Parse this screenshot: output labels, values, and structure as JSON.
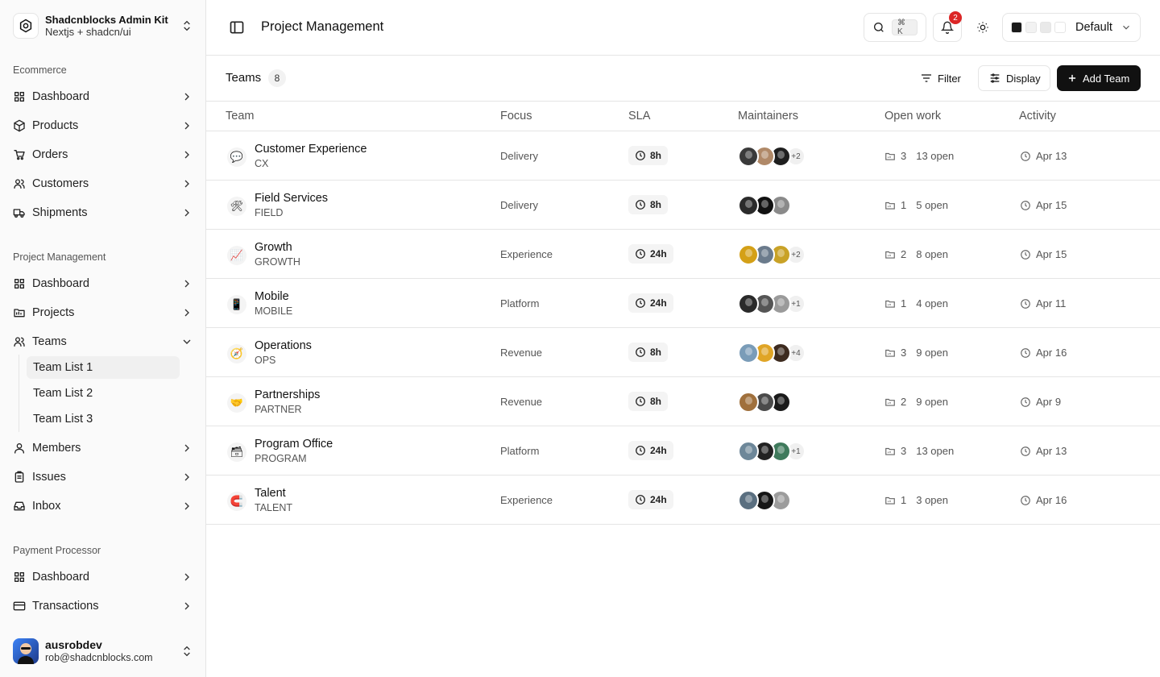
{
  "brand": {
    "title": "Shadcnblocks Admin Kit",
    "subtitle": "Nextjs + shadcn/ui"
  },
  "sidebar": {
    "groups": [
      {
        "label": "Ecommerce",
        "items": [
          {
            "label": "Dashboard",
            "icon": "grid-icon"
          },
          {
            "label": "Products",
            "icon": "box-icon"
          },
          {
            "label": "Orders",
            "icon": "cart-icon"
          },
          {
            "label": "Customers",
            "icon": "users-icon"
          },
          {
            "label": "Shipments",
            "icon": "truck-icon"
          }
        ]
      },
      {
        "label": "Project Management",
        "items": [
          {
            "label": "Dashboard",
            "icon": "grid-icon"
          },
          {
            "label": "Projects",
            "icon": "folder-icon"
          },
          {
            "label": "Teams",
            "icon": "users-icon",
            "expanded": true,
            "children": [
              "Team List 1",
              "Team List 2",
              "Team List 3"
            ],
            "active_child": "Team List 1"
          },
          {
            "label": "Members",
            "icon": "user-icon"
          },
          {
            "label": "Issues",
            "icon": "clipboard-icon"
          },
          {
            "label": "Inbox",
            "icon": "inbox-icon"
          }
        ]
      },
      {
        "label": "Payment Processor",
        "items": [
          {
            "label": "Dashboard",
            "icon": "grid-icon"
          },
          {
            "label": "Transactions",
            "icon": "card-icon"
          }
        ]
      }
    ]
  },
  "user": {
    "name": "ausrobdev",
    "email": "rob@shadcnblocks.com"
  },
  "header": {
    "title": "Project Management",
    "search_kbd": "⌘ K",
    "notifications": "2",
    "theme_name": "Default",
    "swatches": [
      "#1a1a1a",
      "#f2f2f2",
      "#e9e9e9",
      "#ffffff"
    ]
  },
  "toolbar": {
    "title": "Teams",
    "count": "8",
    "filter": "Filter",
    "display": "Display",
    "add": "Add Team"
  },
  "table": {
    "columns": [
      "Team",
      "Focus",
      "SLA",
      "Maintainers",
      "Open work",
      "Activity"
    ],
    "rows": [
      {
        "emoji": "💬",
        "name": "Customer Experience",
        "code": "CX",
        "focus": "Delivery",
        "sla": "8h",
        "avatars": [
          "#3a3a3a",
          "#b08968",
          "#1f1f1f"
        ],
        "more": "+2",
        "projects": "3",
        "open": "13 open",
        "activity": "Apr 13"
      },
      {
        "emoji": "🛠",
        "name": "Field Services",
        "code": "FIELD",
        "focus": "Delivery",
        "sla": "8h",
        "avatars": [
          "#2b2b2b",
          "#111111",
          "#8a8a8a"
        ],
        "more": "",
        "projects": "1",
        "open": "5 open",
        "activity": "Apr 15"
      },
      {
        "emoji": "📈",
        "name": "Growth",
        "code": "GROWTH",
        "focus": "Experience",
        "sla": "24h",
        "avatars": [
          "#d4a017",
          "#6b7b8c",
          "#c9a227"
        ],
        "more": "+2",
        "projects": "2",
        "open": "8 open",
        "activity": "Apr 15"
      },
      {
        "emoji": "📱",
        "name": "Mobile",
        "code": "MOBILE",
        "focus": "Platform",
        "sla": "24h",
        "avatars": [
          "#2a2a2a",
          "#555555",
          "#9a9a9a"
        ],
        "more": "+1",
        "projects": "1",
        "open": "4 open",
        "activity": "Apr 11"
      },
      {
        "emoji": "🧭",
        "name": "Operations",
        "code": "OPS",
        "focus": "Revenue",
        "sla": "8h",
        "avatars": [
          "#7a9cb8",
          "#e0a526",
          "#3d2b1f"
        ],
        "more": "+4",
        "projects": "3",
        "open": "9 open",
        "activity": "Apr 16"
      },
      {
        "emoji": "🤝",
        "name": "Partnerships",
        "code": "PARTNER",
        "focus": "Revenue",
        "sla": "8h",
        "avatars": [
          "#a0703c",
          "#4a4a4a",
          "#1a1a1a"
        ],
        "more": "",
        "projects": "2",
        "open": "9 open",
        "activity": "Apr 9"
      },
      {
        "emoji": "🗃",
        "name": "Program Office",
        "code": "PROGRAM",
        "focus": "Platform",
        "sla": "24h",
        "avatars": [
          "#6d8799",
          "#222222",
          "#3f7a5c"
        ],
        "more": "+1",
        "projects": "3",
        "open": "13 open",
        "activity": "Apr 13"
      },
      {
        "emoji": "🧲",
        "name": "Talent",
        "code": "TALENT",
        "focus": "Experience",
        "sla": "24h",
        "avatars": [
          "#5a6f80",
          "#161616",
          "#9c9c9c"
        ],
        "more": "",
        "projects": "1",
        "open": "3 open",
        "activity": "Apr 16"
      }
    ]
  }
}
